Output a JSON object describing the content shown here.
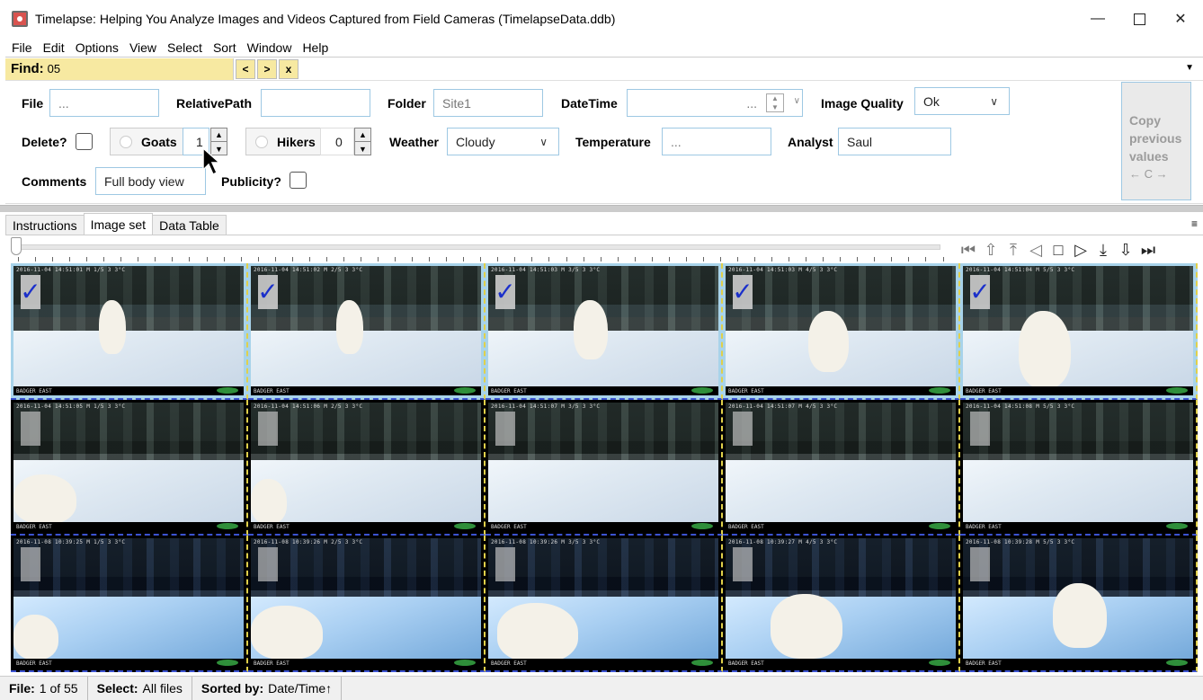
{
  "window": {
    "title": "Timelapse: Helping You Analyze Images and Videos Captured from Field Cameras (TimelapseData.ddb)",
    "minimize": "—",
    "close": "✕"
  },
  "menu": [
    "File",
    "Edit",
    "Options",
    "View",
    "Select",
    "Sort",
    "Window",
    "Help"
  ],
  "find": {
    "label": "Find:",
    "value": "05",
    "prev": "<",
    "next": ">",
    "clear": "x"
  },
  "entry": {
    "file_label": "File",
    "file_value": "...",
    "relpath_label": "RelativePath",
    "relpath_value": "",
    "folder_label": "Folder",
    "folder_value": "Site1",
    "datetime_label": "DateTime",
    "datetime_value": "...",
    "quality_label": "Image Quality",
    "quality_value": "Ok",
    "delete_label": "Delete?",
    "goats_label": "Goats",
    "goats_value": "1",
    "hikers_label": "Hikers",
    "hikers_value": "0",
    "weather_label": "Weather",
    "weather_value": "Cloudy",
    "temperature_label": "Temperature",
    "temperature_value": "...",
    "analyst_label": "Analyst",
    "analyst_value": "Saul",
    "comments_label": "Comments",
    "comments_value": "Full body view",
    "publicity_label": "Publicity?",
    "copy_line1": "Copy",
    "copy_line2": "previous",
    "copy_line3": "values",
    "copy_keys": "← C →"
  },
  "tabs": [
    "Instructions",
    "Image set",
    "Data Table"
  ],
  "active_tab": "Image set",
  "nav_icons": [
    "first-icon",
    "prev-page-icon",
    "prev-row-icon",
    "prev-icon",
    "stop-icon",
    "play-icon",
    "next-row-icon",
    "next-page-icon",
    "last-icon"
  ],
  "thumbnails": [
    {
      "stamp": "2016-11-04 14:51:01   M 1/5        3  3°C",
      "footer": "BADGER EAST",
      "checked": true
    },
    {
      "stamp": "2016-11-04 14:51:02   M 2/5        3  3°C",
      "footer": "BADGER EAST",
      "checked": true
    },
    {
      "stamp": "2016-11-04 14:51:03   M 3/5        3  3°C",
      "footer": "BADGER EAST",
      "checked": true
    },
    {
      "stamp": "2016-11-04 14:51:03   M 4/5        3  3°C",
      "footer": "BADGER EAST",
      "checked": true
    },
    {
      "stamp": "2016-11-04 14:51:04   M 5/5        3  3°C",
      "footer": "BADGER EAST",
      "checked": true
    },
    {
      "stamp": "2016-11-04 14:51:05   M 1/5        3  3°C",
      "footer": "BADGER EAST",
      "checked": false
    },
    {
      "stamp": "2016-11-04 14:51:06   M 2/5        3  3°C",
      "footer": "BADGER EAST",
      "checked": false
    },
    {
      "stamp": "2016-11-04 14:51:07   M 3/5        3  3°C",
      "footer": "BADGER EAST",
      "checked": false
    },
    {
      "stamp": "2016-11-04 14:51:07   M 4/5        3  3°C",
      "footer": "BADGER EAST",
      "checked": false
    },
    {
      "stamp": "2016-11-04 14:51:08   M 5/5        3  3°C",
      "footer": "BADGER EAST",
      "checked": false
    },
    {
      "stamp": "2016-11-08 10:39:25   M 1/5        3  3°C",
      "footer": "BADGER EAST",
      "checked": false
    },
    {
      "stamp": "2016-11-08 10:39:26   M 2/5        3  3°C",
      "footer": "BADGER EAST",
      "checked": false
    },
    {
      "stamp": "2016-11-08 10:39:26   M 3/5        3  3°C",
      "footer": "BADGER EAST",
      "checked": false
    },
    {
      "stamp": "2016-11-08 10:39:27   M 4/5        3  3°C",
      "footer": "BADGER EAST",
      "checked": false
    },
    {
      "stamp": "2016-11-08 10:39:28   M 5/5        3  3°C",
      "footer": "BADGER EAST",
      "checked": false
    }
  ],
  "status": {
    "file_label": "File:",
    "file_value": "1 of 55",
    "select_label": "Select:",
    "select_value": "All files",
    "sorted_label": "Sorted by:",
    "sorted_value": "Date/Time↑"
  }
}
